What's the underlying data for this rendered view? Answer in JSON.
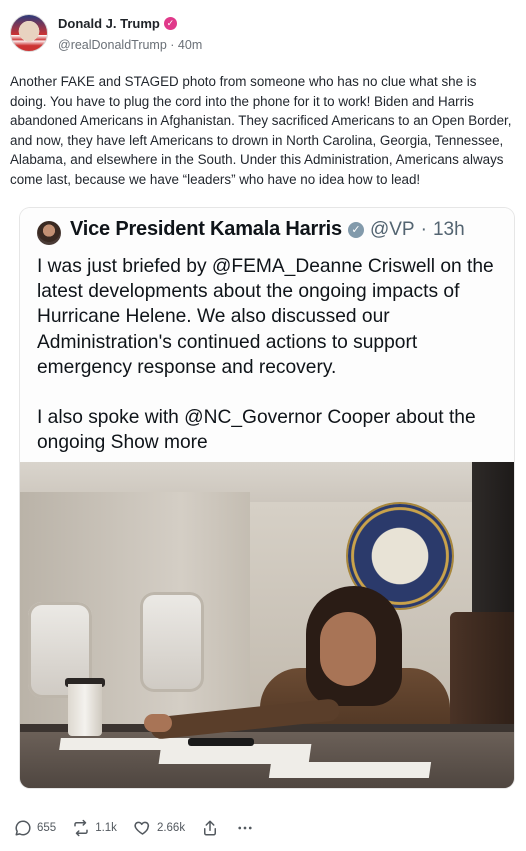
{
  "author": {
    "display_name": "Donald J. Trump",
    "handle": "@realDonaldTrump",
    "time": "40m",
    "verified_color": "#e0398a"
  },
  "post": {
    "text": "Another FAKE and STAGED photo from someone who has no clue what she is doing. You have to plug the cord into the phone for it to work! Biden and Harris abandoned Americans in Afghanistan. They sacrificed Americans to an Open Border, and now, they have left Americans to drown in North Carolina, Georgia, Tennessee, Alabama, and elsewhere in the South. Under this Administration, Americans always come last, because we have “leaders” who have no idea how to lead!"
  },
  "quote": {
    "name": "Vice President Kamala Harris",
    "handle": "@VP",
    "time_sep": "·",
    "time": "13h",
    "paragraph1": "I was just briefed by @FEMA_Deanne Criswell on the latest developments about the ongoing impacts of Hurricane Helene. We also discussed our Administration's continued actions to support emergency response and recovery.",
    "paragraph2": "I also spoke with @NC_Governor Cooper about the ongoing",
    "show_more": "Show more"
  },
  "actions": {
    "replies": "655",
    "reposts": "1.1k",
    "likes": "2.66k"
  }
}
